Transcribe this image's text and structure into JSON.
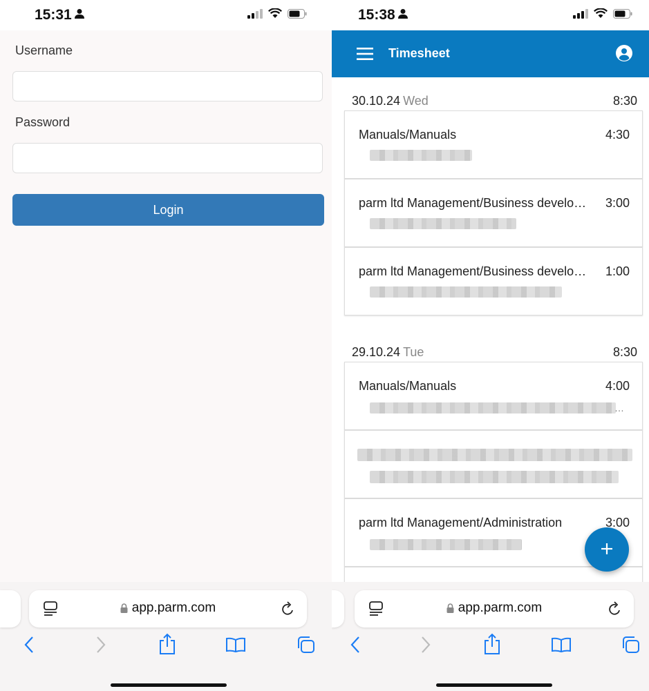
{
  "left": {
    "status_time": "15:31",
    "login": {
      "username_label": "Username",
      "username_value": "",
      "password_label": "Password",
      "password_value": "",
      "login_button": "Login"
    },
    "browser": {
      "url": "app.parm.com"
    }
  },
  "right": {
    "status_time": "15:38",
    "app_bar": {
      "title": "Timesheet"
    },
    "days": [
      {
        "date": "30.10.24",
        "weekday": "Wed",
        "total": "8:30",
        "entries": [
          {
            "title": "Manuals/Manuals",
            "hours": "4:30"
          },
          {
            "title": "parm ltd Management/Business develo…",
            "hours": "3:00"
          },
          {
            "title": "parm ltd Management/Business develo…",
            "hours": "1:00"
          }
        ]
      },
      {
        "date": "29.10.24",
        "weekday": "Tue",
        "total": "8:30",
        "entries": [
          {
            "title": "Manuals/Manuals",
            "hours": "4:00"
          },
          {
            "title": "",
            "hours": ""
          },
          {
            "title": "parm ltd Management/Administration",
            "hours": "3:00"
          }
        ]
      }
    ],
    "fab_icon": "plus-icon",
    "browser": {
      "url": "app.parm.com"
    }
  },
  "colors": {
    "app_bar": "#0a7ac0",
    "login_button": "#3379b7",
    "ios_blue": "#1a7cf5"
  }
}
